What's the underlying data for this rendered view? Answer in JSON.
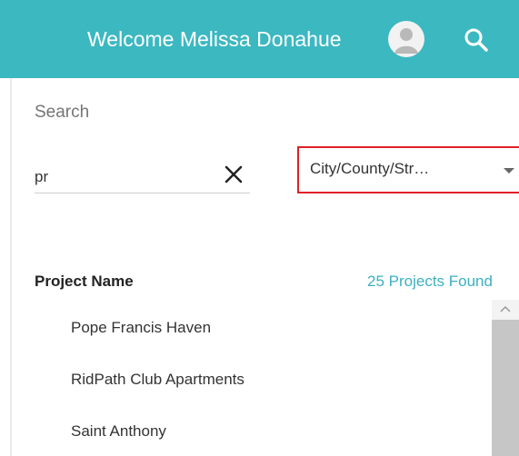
{
  "header": {
    "welcome_text": "Welcome Melissa Donahue",
    "avatar_icon": "user-avatar-icon",
    "search_icon": "search-icon",
    "background_color": "#3cb8c1"
  },
  "search": {
    "label": "Search",
    "input_value": "pr",
    "clear_icon": "close-icon",
    "filter_selected": "City/County/Str…",
    "filter_arrow_icon": "caret-down-icon",
    "highlight_color": "#e0202a"
  },
  "results": {
    "column_header": "Project Name",
    "count_text": "25 Projects Found",
    "count_color": "#3cb0c0",
    "items": [
      {
        "label": "Pope Francis Haven"
      },
      {
        "label": "RidPath Club Apartments"
      },
      {
        "label": "Saint Anthony"
      }
    ]
  }
}
